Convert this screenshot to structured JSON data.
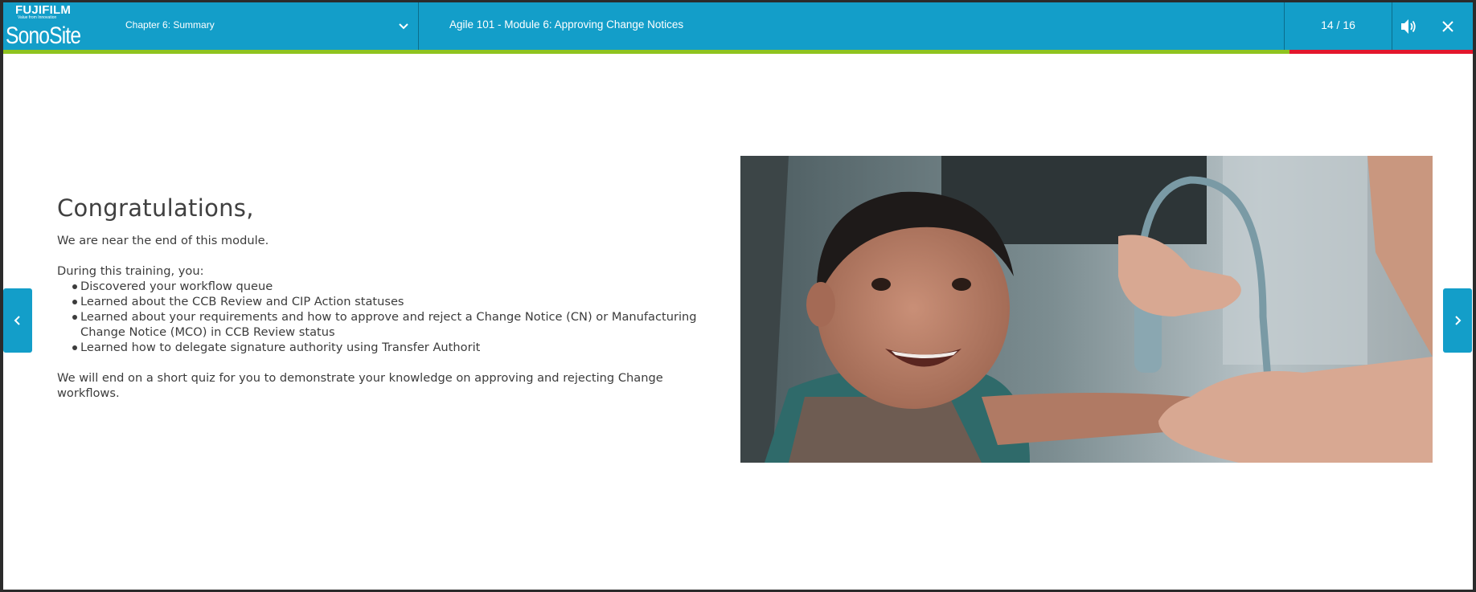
{
  "header": {
    "logo": {
      "brand_top": "FUJIFILM",
      "tagline": "Value from Innovation",
      "brand_main": "SonoSite"
    },
    "chapter_label": "Chapter 6: Summary",
    "course_title": "Agile 101 - Module 6: Approving Change Notices",
    "page_counter": "14 / 16",
    "sound_icon": "speaker-icon",
    "close_icon": "close-icon"
  },
  "progress": {
    "fraction": 0.875,
    "fill_color": "#8fc31f",
    "remaining_color": "#e3172d"
  },
  "content": {
    "heading": "Congratulations,",
    "intro": "We are near the end of this module.",
    "during": "During this training, you:",
    "bullets": [
      "Discovered your workflow queue",
      "Learned about the CCB Review and CIP Action statuses",
      "Learned about your requirements and how to approve and reject a Change Notice (CN) or Manufacturing Change Notice (MCO) in CCB Review status",
      "Learned how to delegate signature authority using Transfer Authorit"
    ],
    "ending": "We will end on a short quiz for you to demonstrate your knowledge on approving and rejecting Change workflows."
  },
  "nav": {
    "prev_icon": "chevron-left-icon",
    "next_icon": "chevron-right-icon"
  },
  "colors": {
    "accent": "#139ec9",
    "text": "#3c3c3c"
  }
}
